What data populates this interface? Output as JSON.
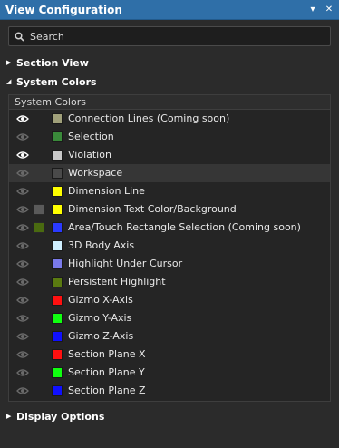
{
  "panel": {
    "title": "View Configuration",
    "pin_icon": "pin-down-icon",
    "close_icon": "close-icon"
  },
  "search": {
    "placeholder": "Search",
    "value": ""
  },
  "sections": {
    "section_view": {
      "label": "Section View",
      "expanded": false
    },
    "system_colors": {
      "label": "System Colors",
      "expanded": true
    },
    "display_options": {
      "label": "Display Options",
      "expanded": false
    }
  },
  "system_colors_table": {
    "column_header": "System Colors",
    "rows": [
      {
        "label": "Connection Lines (Coming soon)",
        "color": "#a0a07a",
        "visible": true
      },
      {
        "label": "Selection",
        "color": "#3a8a3a",
        "visible": false
      },
      {
        "label": "Violation",
        "color": "#c8c8c8",
        "visible": true
      },
      {
        "label": "Workspace",
        "color": "#4a4a4a",
        "visible": false
      },
      {
        "label": "Dimension Line",
        "color": "#ffff00",
        "visible": false
      },
      {
        "label": "Dimension Text Color/Background",
        "color": "#ffff00",
        "extra_color": "#5a5a5a",
        "visible": false
      },
      {
        "label": "Area/Touch Rectangle Selection (Coming soon)",
        "color": "#2a3aff",
        "extra_color": "#4a6a10",
        "visible": false
      },
      {
        "label": "3D Body Axis",
        "color": "#cfefff",
        "visible": false
      },
      {
        "label": "Highlight Under Cursor",
        "color": "#7a7aea",
        "visible": false
      },
      {
        "label": "Persistent Highlight",
        "color": "#5a7a10",
        "visible": false
      },
      {
        "label": "Gizmo X-Axis",
        "color": "#ff1010",
        "visible": false
      },
      {
        "label": "Gizmo Y-Axis",
        "color": "#10ff10",
        "visible": false
      },
      {
        "label": "Gizmo Z-Axis",
        "color": "#1010ff",
        "visible": false
      },
      {
        "label": "Section Plane X",
        "color": "#ff1010",
        "visible": false
      },
      {
        "label": "Section Plane Y",
        "color": "#10ff10",
        "visible": false
      },
      {
        "label": "Section Plane Z",
        "color": "#1010ff",
        "visible": false
      }
    ],
    "selected_index": 3
  },
  "colors": {
    "title_bar": "#2f6fa8",
    "panel_bg": "#2b2b2b"
  }
}
